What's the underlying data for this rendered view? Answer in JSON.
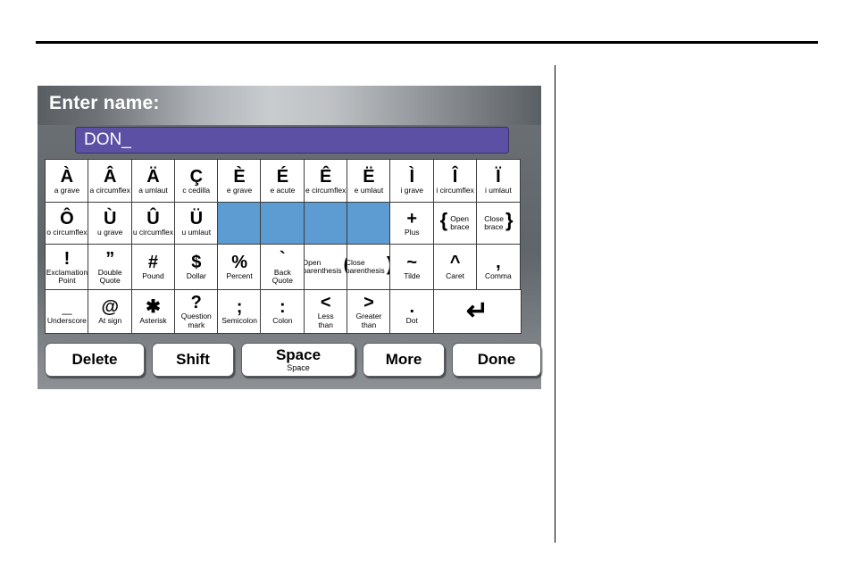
{
  "page": {
    "rule_top": "horizontal-rule",
    "divider": "vertical-divider"
  },
  "keyboard": {
    "title": "Enter name:",
    "entry": {
      "value": "DON_",
      "placeholder": "",
      "accent_color": "#5c50a5"
    },
    "blank_key_color": "#5d9cd2",
    "rows": [
      [
        {
          "glyph": "À",
          "caption": [
            "a grave"
          ]
        },
        {
          "glyph": "Â",
          "caption": [
            "a circumflex"
          ]
        },
        {
          "glyph": "Ä",
          "caption": [
            "a umlaut"
          ]
        },
        {
          "glyph": "Ç",
          "caption": [
            "c cedilla"
          ]
        },
        {
          "glyph": "È",
          "caption": [
            "e grave"
          ]
        },
        {
          "glyph": "É",
          "caption": [
            "e acute"
          ]
        },
        {
          "glyph": "Ê",
          "caption": [
            "e circumflex"
          ]
        },
        {
          "glyph": "Ë",
          "caption": [
            "e umlaut"
          ]
        },
        {
          "glyph": "Ì",
          "caption": [
            "i grave"
          ]
        },
        {
          "glyph": "Î",
          "caption": [
            "i circumflex"
          ]
        },
        {
          "glyph": "Ï",
          "caption": [
            "i umlaut"
          ]
        }
      ],
      [
        {
          "glyph": "Ô",
          "caption": [
            "o circumflex"
          ]
        },
        {
          "glyph": "Ù",
          "caption": [
            "u grave"
          ]
        },
        {
          "glyph": "Û",
          "caption": [
            "u circumflex"
          ]
        },
        {
          "glyph": "Ü",
          "caption": [
            "u umlaut"
          ]
        },
        {
          "blank": true
        },
        {
          "blank": true
        },
        {
          "blank": true
        },
        {
          "blank": true
        },
        {
          "glyph": "+",
          "caption": [
            "Plus"
          ]
        },
        {
          "glyph": "{",
          "caption": [
            "Open",
            "brace"
          ],
          "inline": "sym-first"
        },
        {
          "glyph": "}",
          "caption": [
            "Close",
            "brace"
          ],
          "inline": "sym-last"
        }
      ],
      [
        {
          "glyph": "!",
          "caption": [
            "Exclamation",
            "Point"
          ]
        },
        {
          "glyph": "”",
          "caption": [
            "Double",
            "Quote"
          ]
        },
        {
          "glyph": "#",
          "caption": [
            "Pound"
          ]
        },
        {
          "glyph": "$",
          "caption": [
            "Dollar"
          ]
        },
        {
          "glyph": "%",
          "caption": [
            "Percent"
          ]
        },
        {
          "glyph": "`",
          "caption": [
            "Back",
            "Quote"
          ]
        },
        {
          "glyph": "(",
          "caption": [
            "Open",
            "parenthesis"
          ],
          "inline": "sym-last"
        },
        {
          "glyph": ")",
          "caption": [
            "Close",
            "parenthesis"
          ],
          "inline": "sym-last"
        },
        {
          "glyph": "~",
          "caption": [
            "Tilde"
          ]
        },
        {
          "glyph": "^",
          "caption": [
            "Caret"
          ]
        },
        {
          "glyph": ",",
          "caption": [
            "Comma"
          ]
        }
      ],
      [
        {
          "glyph": "_",
          "caption": [
            "Underscore"
          ]
        },
        {
          "glyph": "@",
          "caption": [
            "At sign"
          ]
        },
        {
          "glyph": "✱",
          "caption": [
            "Asterisk"
          ]
        },
        {
          "glyph": "?",
          "caption": [
            "Question",
            "mark"
          ]
        },
        {
          "glyph": ";",
          "caption": [
            "Semicolon"
          ]
        },
        {
          "glyph": ":",
          "caption": [
            "Colon"
          ]
        },
        {
          "glyph": "<",
          "caption": [
            "Less",
            "than"
          ]
        },
        {
          "glyph": ">",
          "caption": [
            "Greater",
            "than"
          ]
        },
        {
          "glyph": ".",
          "caption": [
            "Dot"
          ]
        },
        {
          "glyph": "↵",
          "caption": [],
          "enter": true,
          "span": 2
        }
      ]
    ],
    "commands": [
      {
        "key": "delete",
        "label": "Delete",
        "sub": ""
      },
      {
        "key": "shift",
        "label": "Shift",
        "sub": ""
      },
      {
        "key": "space",
        "label": "Space",
        "sub": "Space"
      },
      {
        "key": "more",
        "label": "More",
        "sub": ""
      },
      {
        "key": "done",
        "label": "Done",
        "sub": ""
      }
    ]
  }
}
